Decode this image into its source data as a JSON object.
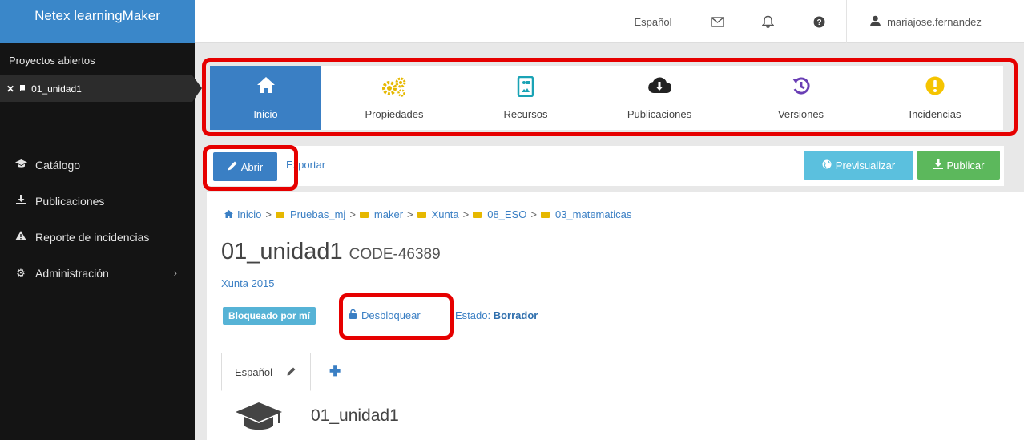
{
  "sidebar": {
    "brand": "Netex learningMaker",
    "open_projects_title": "Proyectos abiertos",
    "open_project": "01_unidad1",
    "nav": [
      {
        "label": "Catálogo",
        "icon": "graduation-cap-icon"
      },
      {
        "label": "Publicaciones",
        "icon": "download-icon"
      },
      {
        "label": "Reporte de incidencias",
        "icon": "warning-icon"
      },
      {
        "label": "Administración",
        "icon": "gear-icon"
      }
    ]
  },
  "topbar": {
    "language": "Español",
    "user": "mariajose.fernandez"
  },
  "modules": [
    {
      "label": "Inicio",
      "icon": "home-icon"
    },
    {
      "label": "Propiedades",
      "icon": "gears-icon"
    },
    {
      "label": "Recursos",
      "icon": "file-image-icon"
    },
    {
      "label": "Publicaciones",
      "icon": "cloud-download-icon"
    },
    {
      "label": "Versiones",
      "icon": "history-icon"
    },
    {
      "label": "Incidencias",
      "icon": "exclamation-circle-icon"
    }
  ],
  "actions": {
    "open": "Abrir",
    "export": "Exportar",
    "preview": "Previsualizar",
    "publish": "Publicar"
  },
  "breadcrumb": [
    "Inicio",
    "Pruebas_mj",
    "maker",
    "Xunta",
    "08_ESO",
    "03_matematicas"
  ],
  "project": {
    "title": "01_unidad1",
    "code": "CODE-46389",
    "subtitle": "Xunta 2015",
    "lock_badge": "Bloqueado por mí",
    "unlock": "Desbloquear",
    "status_label": "Estado:",
    "status_value": "Borrador"
  },
  "lang_tab": "Español",
  "course_title": "01_unidad1",
  "colors": {
    "primary": "#3a7fc4",
    "brand": "#3a87c9",
    "sidebar": "#141414",
    "preview": "#5bc0de",
    "publish": "#5cb85c",
    "highlight": "#e60000",
    "folder": "#e6b800"
  }
}
